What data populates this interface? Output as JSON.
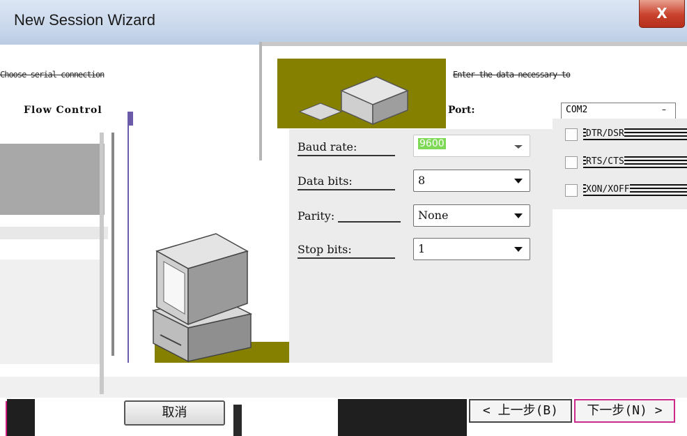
{
  "window": {
    "title": "New Session Wizard",
    "close_label": "X"
  },
  "left_panel": {
    "garbled_text": "Choose serial connection",
    "flow_label": "Flow Control"
  },
  "right_panel": {
    "garbled_text": "Enter the data necessary to",
    "port_label": "Port:",
    "port_value": "COM2"
  },
  "flow_control": {
    "options": [
      "DTR/DSR",
      "RTS/CTS",
      "XON/XOFF"
    ]
  },
  "settings": {
    "baud_label": "Baud rate:",
    "baud_value": "9600",
    "data_bits_label": "Data bits:",
    "data_bits_value": "8",
    "parity_label": "Parity:",
    "parity_value": "None",
    "stop_bits_label": "Stop bits:",
    "stop_bits_value": "1"
  },
  "buttons": {
    "cancel": "取消",
    "back": "< 上一步(B)",
    "next": "下一步(N) >"
  },
  "colors": {
    "olive": "#868000",
    "highlight_green": "#7ed957",
    "title_gradient": "#c7d6ea",
    "close_red": "#c8412c"
  }
}
